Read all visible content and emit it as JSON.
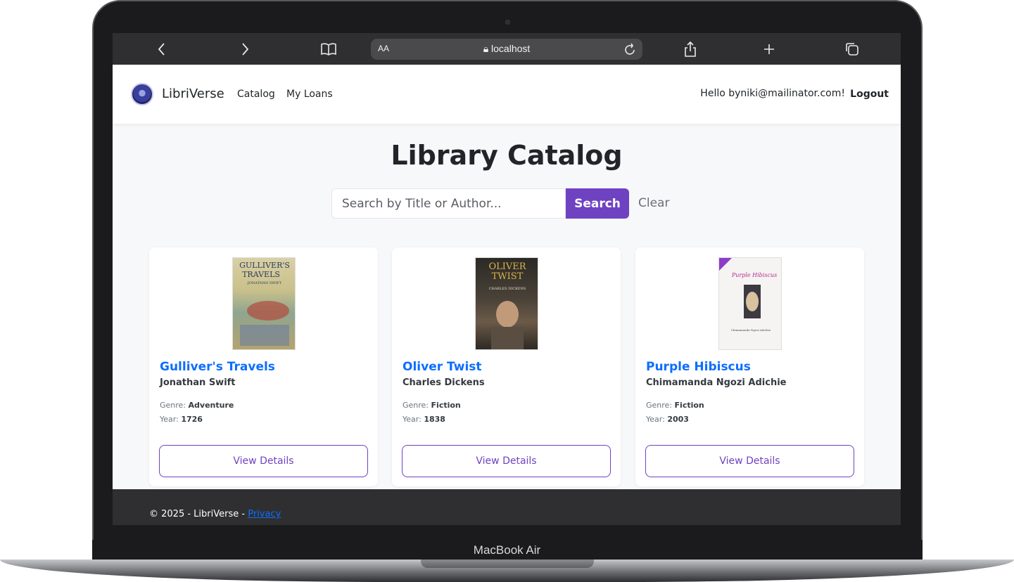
{
  "browser": {
    "url": "localhost",
    "aa_label": "AA"
  },
  "nav": {
    "brand": "LibriVerse",
    "links": [
      "Catalog",
      "My Loans"
    ],
    "greeting": "Hello byniki@mailinator.com!",
    "logout": "Logout"
  },
  "page": {
    "title": "Library Catalog"
  },
  "search": {
    "placeholder": "Search by Title or Author...",
    "button": "Search",
    "clear": "Clear"
  },
  "books": [
    {
      "title": "Gulliver's Travels",
      "author": "Jonathan Swift",
      "genre_label": "Genre:",
      "genre": "Adventure",
      "year_label": "Year:",
      "year": "1726",
      "cover_lines": [
        "GULLIVER'S",
        "TRAVELS",
        "JONATHAN SWIFT"
      ],
      "button": "View Details"
    },
    {
      "title": "Oliver Twist",
      "author": "Charles Dickens",
      "genre_label": "Genre:",
      "genre": "Fiction",
      "year_label": "Year:",
      "year": "1838",
      "cover_lines": [
        "OLIVER",
        "TWIST",
        "CHARLES DICKENS"
      ],
      "button": "View Details"
    },
    {
      "title": "Purple Hibiscus",
      "author": "Chimamanda Ngozi Adichie",
      "genre_label": "Genre:",
      "genre": "Fiction",
      "year_label": "Year:",
      "year": "2003",
      "cover_lines": [
        "Purple Hibiscus",
        "Chimamanda Ngozi Adichie"
      ],
      "button": "View Details"
    }
  ],
  "footer": {
    "text": "© 2025 - LibriVerse - ",
    "link": "Privacy"
  },
  "device": {
    "model": "MacBook Air"
  },
  "colors": {
    "accent": "#6f42c1",
    "link": "#0d6efd",
    "footer_bg": "#2f2f31"
  }
}
